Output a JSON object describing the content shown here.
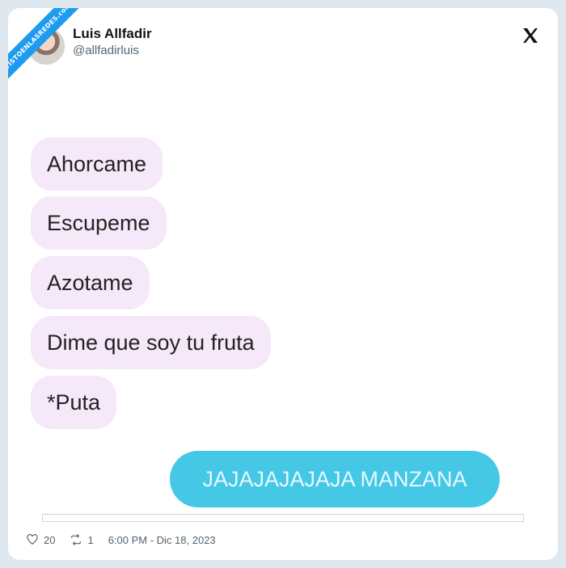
{
  "watermark": "VISTOENLASREDES.com",
  "author": {
    "name": "Luis Allfadir",
    "handle": "@allfadirluis"
  },
  "messages": [
    "Ahorcame",
    "Escupeme",
    "Azotame",
    "Dime que soy tu fruta",
    "*Puta"
  ],
  "reply": "JAJAJAJAJAJA MANZANA",
  "footer": {
    "likes": "20",
    "retweets": "1",
    "timestamp": "6:00 PM - Dic 18, 2023"
  },
  "colors": {
    "incoming_bubble": "#f5e8f8",
    "outgoing_bubble": "#44c8e6",
    "accent": "#1d9bf0"
  }
}
